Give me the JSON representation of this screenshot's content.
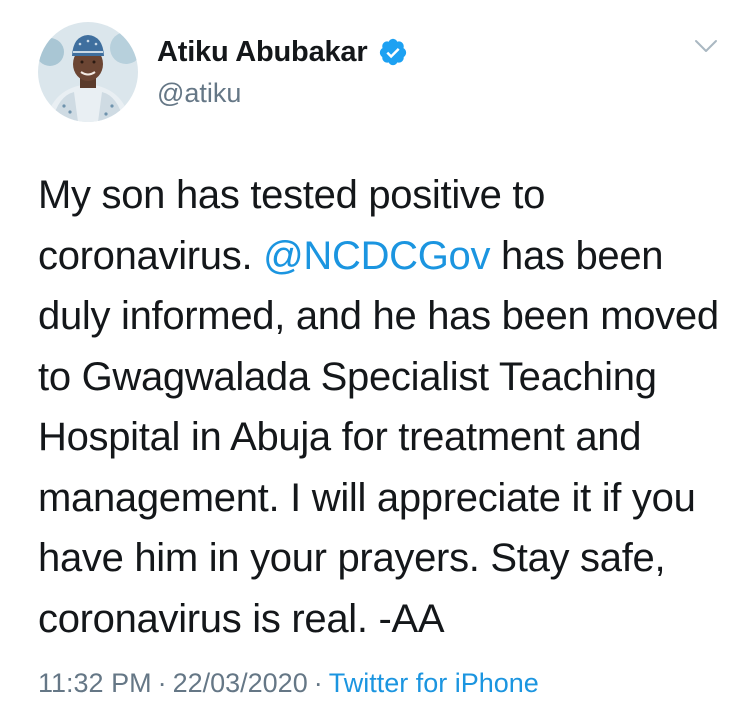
{
  "tweet": {
    "author": {
      "name": "Atiku Abubakar",
      "handle": "@atiku",
      "verified": true,
      "avatar_icon": "profile-photo-avatar"
    },
    "menu_icon": "chevron-down-icon",
    "text": {
      "line1": "My son has tested positive to",
      "line2_before": "coronavirus. ",
      "line2_mention": "@NCDCGov",
      "line2_after": " has been",
      "line3": "duly informed, and he has been moved",
      "line4": "to Gwagwalada Specialist Teaching",
      "line5": "Hospital in Abuja for treatment and",
      "line6": "management. I will appreciate it if you",
      "line7": "have him in your prayers. Stay safe,",
      "line8": "coronavirus is real. -AA"
    },
    "meta": {
      "time": "11:32 PM",
      "separator": "·",
      "date": "22/03/2020",
      "source": "Twitter for iPhone"
    },
    "colors": {
      "text": "#14171a",
      "secondary": "#657786",
      "link": "#1b95e0",
      "verified_badge": "#1da1f2"
    }
  }
}
